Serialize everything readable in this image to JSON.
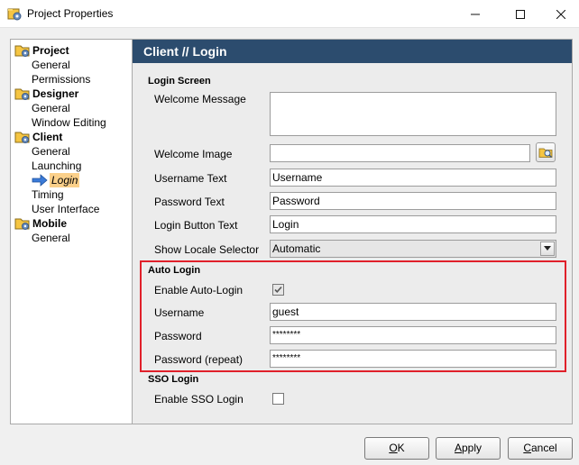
{
  "window": {
    "title": "Project Properties"
  },
  "tree": {
    "groups": [
      {
        "label": "Project",
        "items": [
          "General",
          "Permissions"
        ]
      },
      {
        "label": "Designer",
        "items": [
          "General",
          "Window Editing"
        ]
      },
      {
        "label": "Client",
        "items": [
          "General",
          "Launching",
          "Login",
          "Timing",
          "User Interface"
        ]
      },
      {
        "label": "Mobile",
        "items": [
          "General"
        ]
      }
    ],
    "selected": "Login"
  },
  "panel": {
    "header": "Client // Login",
    "login_screen": {
      "section_label": "Login Screen",
      "welcome_message_label": "Welcome Message",
      "welcome_message_value": "",
      "welcome_image_label": "Welcome Image",
      "welcome_image_value": "",
      "username_text_label": "Username Text",
      "username_text_value": "Username",
      "password_text_label": "Password Text",
      "password_text_value": "Password",
      "login_button_text_label": "Login Button Text",
      "login_button_text_value": "Login",
      "show_locale_selector_label": "Show Locale Selector",
      "show_locale_selector_value": "Automatic"
    },
    "auto_login": {
      "section_label": "Auto Login",
      "enable_label": "Enable Auto-Login",
      "enabled": true,
      "username_label": "Username",
      "username_value": "guest",
      "password_label": "Password",
      "password_value": "********",
      "password_repeat_label": "Password (repeat)",
      "password_repeat_value": "********"
    },
    "sso_login": {
      "section_label": "SSO Login",
      "enable_label": "Enable SSO Login",
      "enabled": false
    }
  },
  "buttons": {
    "ok": {
      "mnemonic": "O",
      "rest": "K"
    },
    "apply": {
      "mnemonic": "A",
      "rest": "pply"
    },
    "cancel": {
      "mnemonic": "C",
      "rest": "ancel"
    }
  },
  "colors": {
    "header_bg": "#2c4c6e",
    "highlight_border": "#e0202a",
    "selected_bg": "#fbd08a"
  }
}
